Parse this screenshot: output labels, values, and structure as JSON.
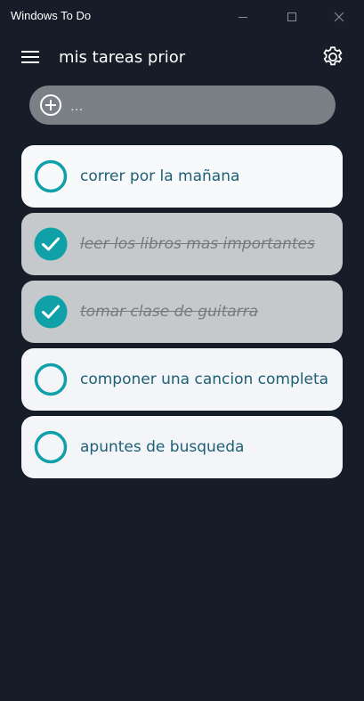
{
  "window": {
    "title": "Windows To Do"
  },
  "header": {
    "title": "mis tareas prior"
  },
  "add_task": {
    "placeholder": "..."
  },
  "tasks": [
    {
      "label": "correr por la mañana",
      "completed": false
    },
    {
      "label": "leer los libros mas importantes",
      "completed": true
    },
    {
      "label": "tomar clase de guitarra",
      "completed": true
    },
    {
      "label": "componer una cancion completa",
      "completed": false
    },
    {
      "label": "apuntes de busqueda",
      "completed": false
    }
  ],
  "icons": {
    "menu": "hamburger-menu-icon",
    "settings": "gear-icon",
    "add": "plus-circle-icon",
    "unchecked": "circle-icon",
    "checked": "check-circle-icon"
  },
  "colors": {
    "background": "#161c28",
    "accent": "#0fa0a8",
    "task_open": "#f3f5f8",
    "task_done": "#c5c9cc",
    "task_text": "#1d6077"
  }
}
